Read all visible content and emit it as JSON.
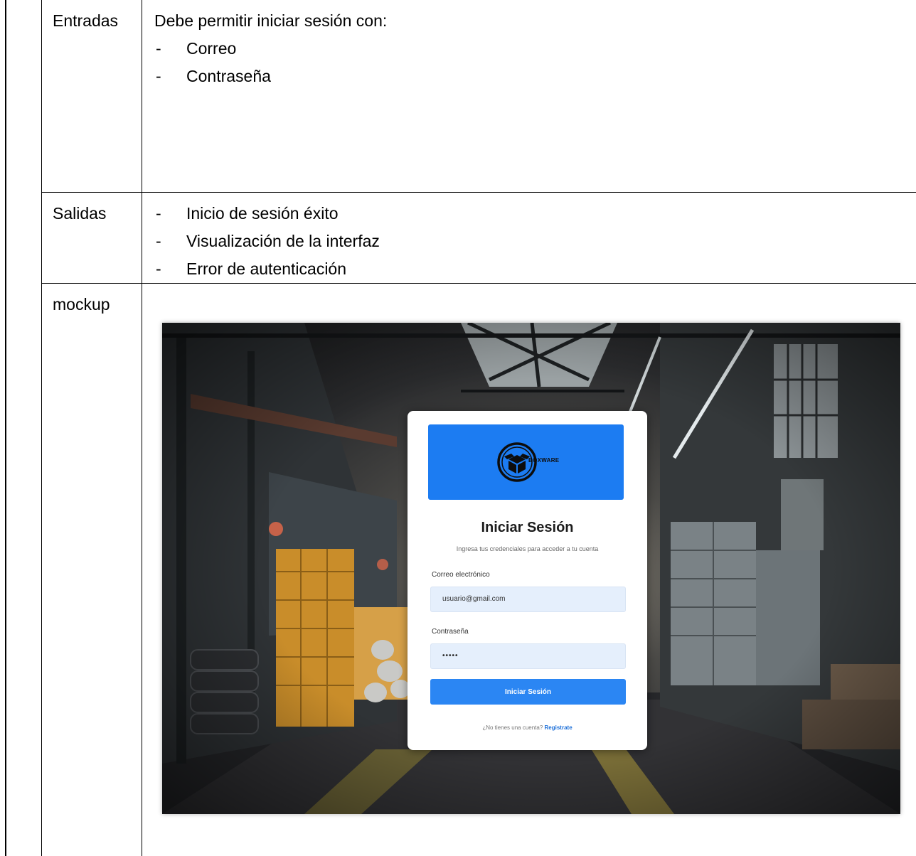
{
  "rows": {
    "inputs": {
      "label": "Entradas",
      "intro": "Debe permitir iniciar sesión con:",
      "items": [
        "Correo",
        "Contraseña"
      ]
    },
    "outputs": {
      "label": "Salidas",
      "items": [
        "Inicio de sesión éxito",
        "Visualización de la interfaz",
        "Error de autenticación"
      ]
    },
    "mockup": {
      "label": "mockup"
    }
  },
  "bullet_marker": "-",
  "login": {
    "logo_text": "BOXWARE",
    "title": "Iniciar Sesión",
    "subtitle": "Ingresa tus credenciales  para acceder a tu cuenta",
    "email_label": "Correo electrónico",
    "email_value": "usuario@gmail.com",
    "password_label": "Contraseña",
    "password_value": "•••••",
    "submit_label": "Iniciar Sesión",
    "signup_prompt": "¿No tienes  una cuenta? ",
    "signup_link": "Registrate"
  },
  "colors": {
    "banner": "#1c7cf2",
    "button": "#2b86f3",
    "input_bg": "#e5effc",
    "link": "#1c6fd8"
  }
}
